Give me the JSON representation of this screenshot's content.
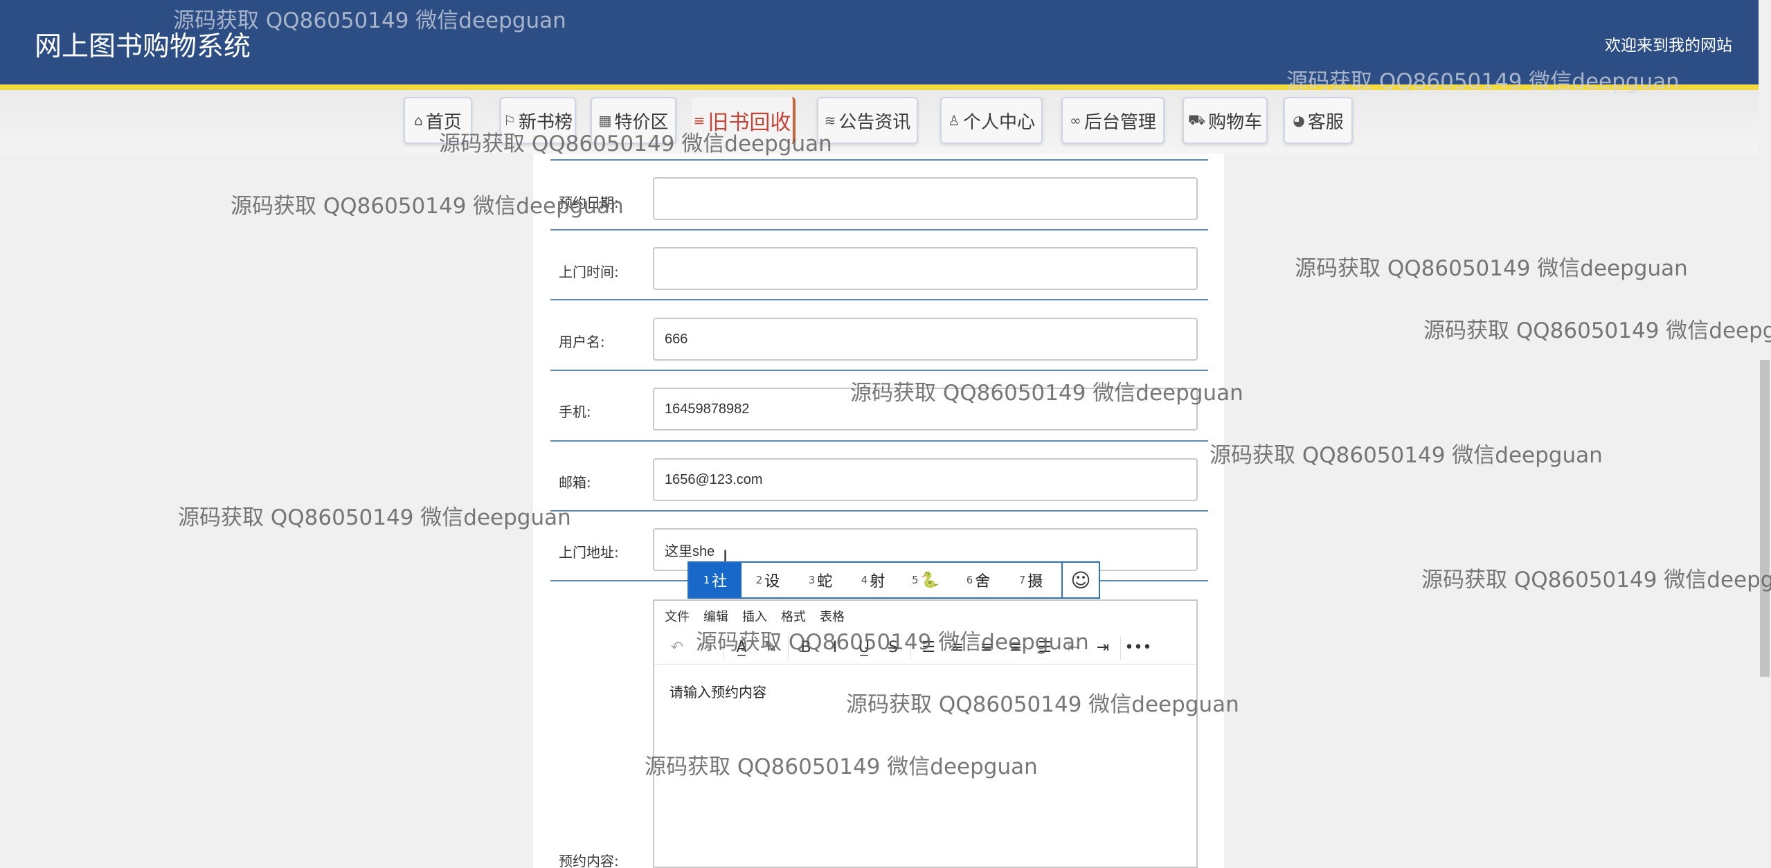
{
  "header": {
    "site_title": "网上图书购物系统",
    "welcome": "欢迎来到我的网站"
  },
  "nav": [
    {
      "label": "首页",
      "icon": "home-icon",
      "glyph": "⌂"
    },
    {
      "label": "新书榜",
      "icon": "flag-icon",
      "glyph": "⚐"
    },
    {
      "label": "特价区",
      "icon": "grid-icon",
      "glyph": "▦"
    },
    {
      "label": "旧书回收",
      "icon": "filter-icon",
      "glyph": "≡",
      "active": true
    },
    {
      "label": "公告资讯",
      "icon": "layers-icon",
      "glyph": "≋"
    },
    {
      "label": "个人中心",
      "icon": "user-icon",
      "glyph": "♙"
    },
    {
      "label": "后台管理",
      "icon": "link-icon",
      "glyph": "∞"
    },
    {
      "label": "购物车",
      "icon": "cart-icon",
      "glyph": "⛟"
    },
    {
      "label": "客服",
      "icon": "headset-icon",
      "glyph": "◕"
    }
  ],
  "form": {
    "date_label": "预约日期:",
    "date_value": "",
    "time_label": "上门时间:",
    "time_value": "",
    "username_label": "用户名:",
    "username_value": "666",
    "phone_label": "手机:",
    "phone_value": "16459878982",
    "email_label": "邮箱:",
    "email_value": "1656@123.com",
    "address_label": "上门地址:",
    "address_value": "这里she",
    "content_label": "预约内容:"
  },
  "ime": {
    "candidates": [
      {
        "num": "1",
        "text": "社"
      },
      {
        "num": "2",
        "text": "设"
      },
      {
        "num": "3",
        "text": "蛇"
      },
      {
        "num": "4",
        "text": "射"
      },
      {
        "num": "5",
        "text": "🐍"
      },
      {
        "num": "6",
        "text": "舍"
      },
      {
        "num": "7",
        "text": "摄"
      }
    ],
    "emoji_glyph": "☺"
  },
  "editor": {
    "menu": [
      "文件",
      "编辑",
      "插入",
      "格式",
      "表格"
    ],
    "toolbar": [
      {
        "name": "undo-icon",
        "glyph": "↶",
        "dim": true
      },
      {
        "name": "redo-icon",
        "glyph": "↷",
        "dim": true
      },
      {
        "sep": true
      },
      {
        "name": "font-color-icon",
        "glyph": "A̲"
      },
      {
        "name": "highlight-icon",
        "glyph": "✎"
      },
      {
        "sep": true
      },
      {
        "name": "bold-icon",
        "glyph": "B"
      },
      {
        "name": "italic-icon",
        "glyph": "I"
      },
      {
        "name": "underline-icon",
        "glyph": "U̲"
      },
      {
        "name": "strikethrough-icon",
        "glyph": "S̶"
      },
      {
        "sep": true
      },
      {
        "name": "align-none-icon",
        "glyph": "☰"
      },
      {
        "name": "align-left-icon",
        "glyph": "≡"
      },
      {
        "name": "align-center-icon",
        "glyph": "≡"
      },
      {
        "name": "align-right-icon",
        "glyph": "≡"
      },
      {
        "name": "align-justify-icon",
        "glyph": "☰"
      },
      {
        "name": "outdent-icon",
        "glyph": "⇤",
        "dim": true
      },
      {
        "name": "indent-icon",
        "glyph": "⇥"
      },
      {
        "sep": true
      },
      {
        "name": "more-icon",
        "glyph": "•••"
      }
    ],
    "placeholder": "请输入预约内容"
  },
  "watermark": "源码获取 QQ86050149 微信deepguan"
}
